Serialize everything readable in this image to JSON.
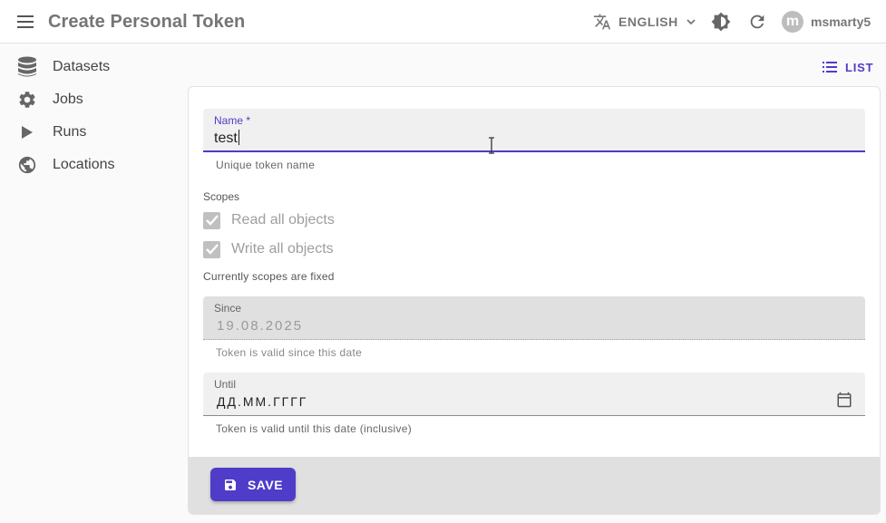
{
  "header": {
    "title": "Create Personal Token",
    "language_label": "ENGLISH",
    "username": "msmarty5",
    "avatar_letter": "m"
  },
  "sidebar": {
    "items": [
      {
        "label": "Datasets",
        "icon": "database-icon"
      },
      {
        "label": "Jobs",
        "icon": "gear-icon"
      },
      {
        "label": "Runs",
        "icon": "play-icon"
      },
      {
        "label": "Locations",
        "icon": "globe-icon"
      }
    ]
  },
  "actions": {
    "list_label": "LIST"
  },
  "form": {
    "name": {
      "label": "Name *",
      "value": "test",
      "helper": "Unique token name"
    },
    "scopes": {
      "label": "Scopes",
      "options": [
        {
          "label": "Read all objects",
          "checked": true
        },
        {
          "label": "Write all objects",
          "checked": true
        }
      ],
      "note": "Currently scopes are fixed"
    },
    "since": {
      "label": "Since",
      "value": "19.08.2025",
      "helper": "Token is valid since this date"
    },
    "until": {
      "label": "Until",
      "placeholder": "ДД.ММ.ГГГГ",
      "helper": "Token is valid until this date (inclusive)"
    }
  },
  "toolbar": {
    "save_label": "SAVE"
  },
  "colors": {
    "accent": "#4f3cc9",
    "toolbar_bg": "#e0e0e0"
  }
}
